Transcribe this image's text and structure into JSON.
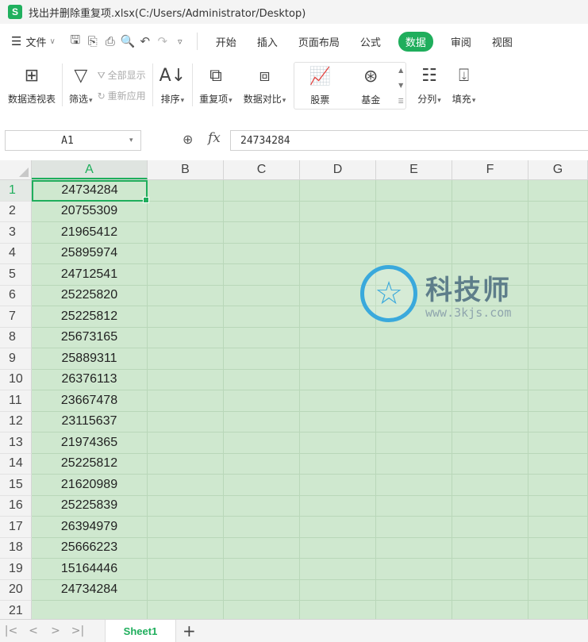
{
  "window": {
    "app_badge": "S",
    "title": "找出并删除重复项.xlsx(C:/Users/Administrator/Desktop)"
  },
  "menu": {
    "file_label": "文件",
    "tabs": [
      {
        "label": "开始",
        "active": false
      },
      {
        "label": "插入",
        "active": false
      },
      {
        "label": "页面布局",
        "active": false
      },
      {
        "label": "公式",
        "active": false
      },
      {
        "label": "数据",
        "active": true
      },
      {
        "label": "审阅",
        "active": false
      },
      {
        "label": "视图",
        "active": false
      }
    ]
  },
  "ribbon": {
    "pivot": "数据透视表",
    "filter": "筛选",
    "show_all": "全部显示",
    "reapply": "重新应用",
    "sort": "排序",
    "duplicates": "重复项",
    "compare": "数据对比",
    "stock": "股票",
    "fund": "基金",
    "split": "分列",
    "fill": "填充"
  },
  "formula_bar": {
    "name_box": "A1",
    "formula": "24734284"
  },
  "grid": {
    "columns": [
      "A",
      "B",
      "C",
      "D",
      "E",
      "F",
      "G"
    ],
    "active_column": "A",
    "active_row": 1,
    "rows": [
      {
        "n": "1",
        "a": "24734284"
      },
      {
        "n": "2",
        "a": "20755309"
      },
      {
        "n": "3",
        "a": "21965412"
      },
      {
        "n": "4",
        "a": "25895974"
      },
      {
        "n": "5",
        "a": "24712541"
      },
      {
        "n": "6",
        "a": "25225820"
      },
      {
        "n": "7",
        "a": "25225812"
      },
      {
        "n": "8",
        "a": "25673165"
      },
      {
        "n": "9",
        "a": "25889311"
      },
      {
        "n": "10",
        "a": "26376113"
      },
      {
        "n": "11",
        "a": "23667478"
      },
      {
        "n": "12",
        "a": "23115637"
      },
      {
        "n": "13",
        "a": "21974365"
      },
      {
        "n": "14",
        "a": "25225812"
      },
      {
        "n": "15",
        "a": "21620989"
      },
      {
        "n": "16",
        "a": "25225839"
      },
      {
        "n": "17",
        "a": "26394979"
      },
      {
        "n": "18",
        "a": "25666223"
      },
      {
        "n": "19",
        "a": "15164446"
      },
      {
        "n": "20",
        "a": "24734284"
      },
      {
        "n": "21",
        "a": ""
      }
    ]
  },
  "watermark": {
    "brand": "科技师",
    "url": "www.3kjs.com"
  },
  "sheets": {
    "active": "Sheet1"
  },
  "colors": {
    "accent": "#1fae5c",
    "cell_fill": "#cfe8cf"
  }
}
